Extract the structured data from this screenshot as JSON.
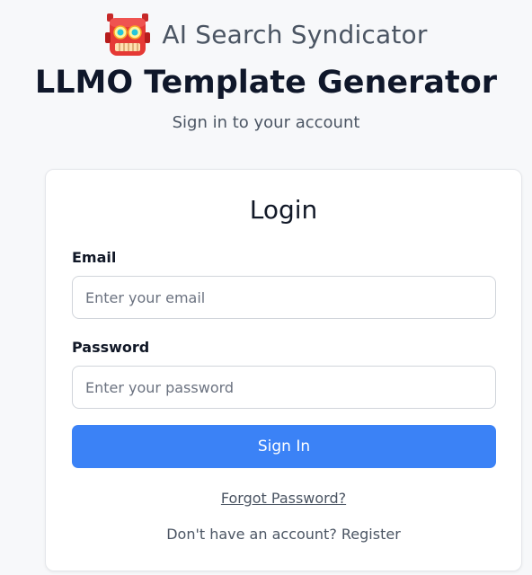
{
  "brand": {
    "name": "AI Search Syndicator",
    "icon": "robot-icon",
    "icon_color": "#e53935"
  },
  "header": {
    "title": "LLMO Template Generator",
    "subtitle": "Sign in to your account"
  },
  "login": {
    "title": "Login",
    "email": {
      "label": "Email",
      "placeholder": "Enter your email",
      "value": ""
    },
    "password": {
      "label": "Password",
      "placeholder": "Enter your password",
      "value": ""
    },
    "submit_label": "Sign In",
    "forgot_label": "Forgot Password?",
    "register_prompt": "Don't have an account? ",
    "register_label": "Register"
  },
  "colors": {
    "accent": "#3b82f6",
    "background": "#f7f8fa",
    "card": "#ffffff"
  }
}
